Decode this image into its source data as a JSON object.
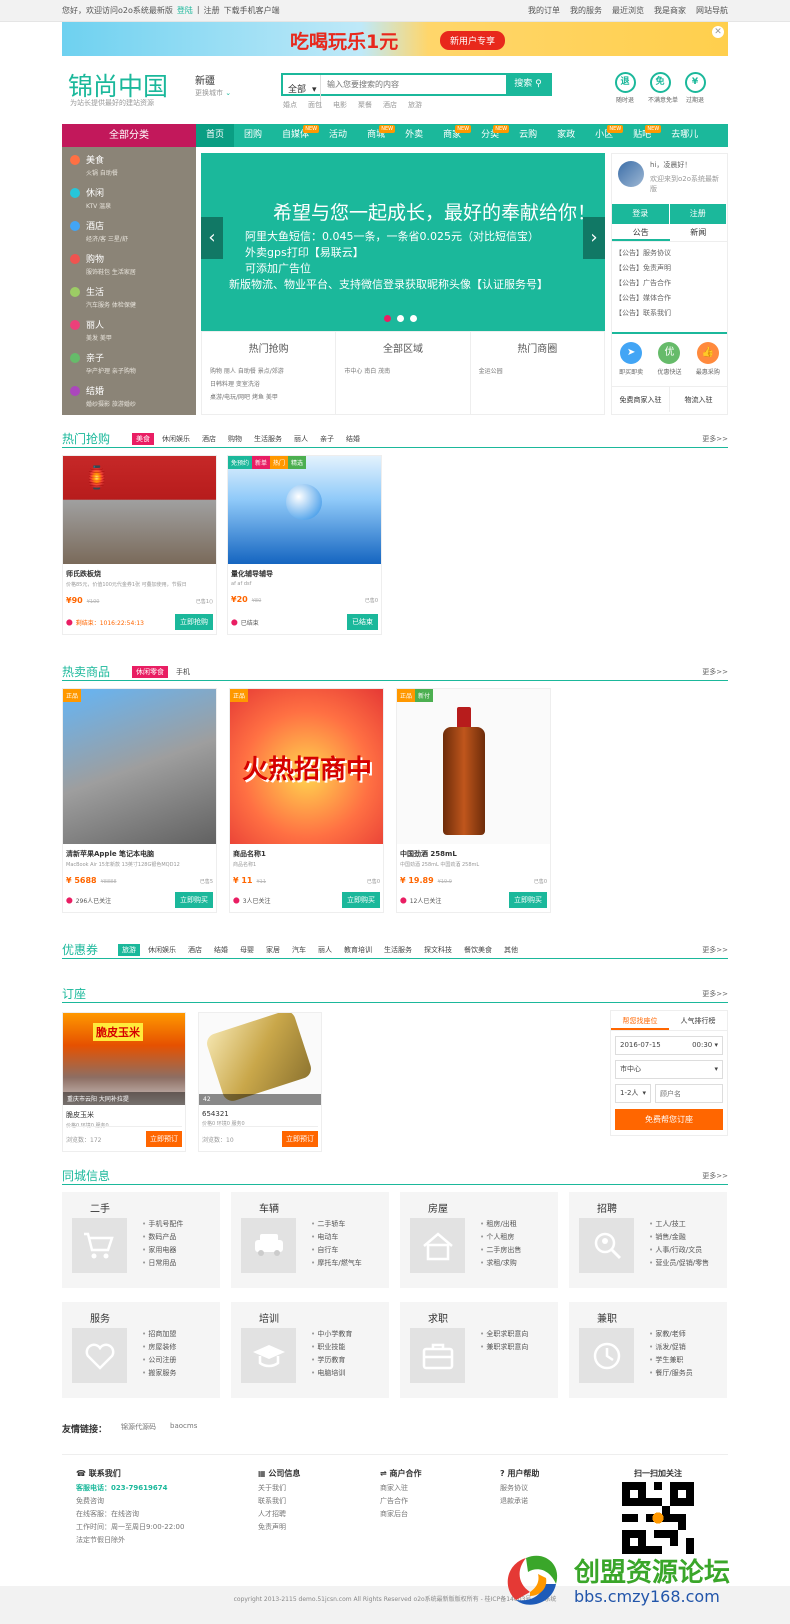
{
  "topbar": {
    "greeting": "您好，欢迎访问o2o系统最新版",
    "login": "登陆",
    "sep": "|",
    "register": "注册",
    "download": "下载手机客户端",
    "links": [
      "我的订单",
      "我的服务",
      "最近浏览",
      "我是商家",
      "网站导航"
    ]
  },
  "banner": {
    "text": "吃喝玩乐1元",
    "pill": "新用户专享",
    "close": "✕"
  },
  "header": {
    "logo": "锦尚中国",
    "logo_sub": "为站长提供最好的建站资源",
    "city": "新疆",
    "city_sub": "更换城市",
    "search_cat": "全部",
    "search_placeholder": "输入您要搜索的内容",
    "search_btn": "搜索",
    "hotwords": [
      "婚点",
      "面包",
      "电影",
      "聚餐",
      "酒店",
      "旅游"
    ],
    "services": [
      {
        "icon": "退",
        "label": "随时退"
      },
      {
        "icon": "免",
        "label": "不满意免单"
      },
      {
        "icon": "¥",
        "label": "过期退"
      }
    ]
  },
  "nav": {
    "all": "全部分类",
    "items": [
      {
        "label": "首页",
        "badge": ""
      },
      {
        "label": "团购",
        "badge": ""
      },
      {
        "label": "自媒体",
        "badge": "NEW"
      },
      {
        "label": "活动",
        "badge": ""
      },
      {
        "label": "商城",
        "badge": "NEW"
      },
      {
        "label": "外卖",
        "badge": ""
      },
      {
        "label": "商家",
        "badge": "NEW"
      },
      {
        "label": "分类",
        "badge": "NEW"
      },
      {
        "label": "云购",
        "badge": ""
      },
      {
        "label": "家政",
        "badge": ""
      },
      {
        "label": "小区",
        "badge": "NEW"
      },
      {
        "label": "贴吧",
        "badge": "NEW"
      },
      {
        "label": "去哪儿",
        "badge": ""
      }
    ]
  },
  "categories": [
    {
      "name": "美食",
      "sub": "火锅  自助餐",
      "color": "#ff7043"
    },
    {
      "name": "休闲",
      "sub": "KTV  温泉",
      "color": "#26c6da"
    },
    {
      "name": "酒店",
      "sub": "经济/客  三星/舒",
      "color": "#42a5f5"
    },
    {
      "name": "购物",
      "sub": "服饰鞋包  生活家居",
      "color": "#ef5350"
    },
    {
      "name": "生活",
      "sub": "汽车服务  体检保健",
      "color": "#9ccc65"
    },
    {
      "name": "丽人",
      "sub": "美发  美甲",
      "color": "#ec407a"
    },
    {
      "name": "亲子",
      "sub": "孕产护理  亲子购物",
      "color": "#66bb6a"
    },
    {
      "name": "结婚",
      "sub": "婚纱摄影  旅游婚纱",
      "color": "#ab47bc"
    }
  ],
  "slider": {
    "headline": "希望与您一起成长，最好的奉献给你！",
    "lines": [
      "阿里大鱼短信：0.045一条，一条省0.025元（对比短信宝）",
      "外卖gps打印【易联云】",
      "可添加广告位",
      "新版物流、物业平台、支持微信登录获取昵称头像【认证服务号】"
    ],
    "prev": "‹",
    "next": "›"
  },
  "quick": [
    {
      "title": "热门抢购",
      "links": [
        "购物  丽人  自助餐  景点/郊游",
        "日韩料理  变室洗浴",
        "桌游/电玩/网吧  烤鱼  美甲"
      ]
    },
    {
      "title": "全部区域",
      "links": [
        "市中心  南白  茂南"
      ]
    },
    {
      "title": "热门商圈",
      "links": [
        "金运公园"
      ]
    }
  ],
  "rside": {
    "hi": "hi，",
    "greet": "凌晨好！",
    "welcome": "欢迎来到o2o系统最新版",
    "login": "登录",
    "register": "注册",
    "tabs": [
      "公告",
      "新闻"
    ],
    "notices": [
      "【公告】服务协议",
      "【公告】免责声明",
      "【公告】广告合作",
      "【公告】媒体合作",
      "【公告】联系我们"
    ],
    "icons": [
      {
        "glyph": "➤",
        "label": "即买即卖",
        "color": "#42a5f5"
      },
      {
        "glyph": "优",
        "label": "优惠快送",
        "color": "#66bb6a"
      },
      {
        "glyph": "👍",
        "label": "最惠采购",
        "color": "#ff8a3d"
      }
    ],
    "foot": [
      "免费商家入驻",
      "物流入驻"
    ]
  },
  "hot_buy": {
    "title": "热门抢购",
    "tabs": [
      "美食",
      "休闲娱乐",
      "酒店",
      "购物",
      "生活服务",
      "丽人",
      "亲子",
      "结婚"
    ],
    "more": "更多>>",
    "items": [
      {
        "name": "师氏跌板烧",
        "desc": "价格85元，价值100元代金券1张 可叠加使用，节假日",
        "price": "¥90",
        "old": "¥100",
        "sold": "已售1()",
        "time": "剩结束：1016:22:54:13",
        "btn": "立即抢购",
        "tags": []
      },
      {
        "name": "量化辅导辅导",
        "desc": "af af dsf",
        "price": "¥20",
        "old": "¥80",
        "sold": "已售0",
        "time": "已结束",
        "btn": "已结束",
        "tags": [
          {
            "t": "免预约",
            "c": "#1bb89b"
          },
          {
            "t": "新单",
            "c": "#e91e63"
          },
          {
            "t": "热门",
            "c": "#ff9800"
          },
          {
            "t": "精选",
            "c": "#4caf50"
          }
        ]
      }
    ]
  },
  "hot_goods": {
    "title": "热卖商品",
    "tabs": [
      "休闲零食",
      "手机"
    ],
    "more": "更多>>",
    "items": [
      {
        "name": "清新苹果Apple 笔记本电脑",
        "desc": "MacBook Air 15年新款 13英寸128G银色MQD12",
        "price": "¥ 5688",
        "old": "¥8888",
        "sold": "已售5",
        "fav": "296人已关注",
        "btn": "立即购买",
        "tags": [
          {
            "t": "正品",
            "c": "#ff9800"
          }
        ]
      },
      {
        "name": "商品名称1",
        "desc": "商品名称1",
        "price": "¥ 11",
        "old": "¥11",
        "sold": "已售0",
        "fav": "3人已关注",
        "btn": "立即购买",
        "tags": [
          {
            "t": "正品",
            "c": "#ff9800"
          }
        ]
      },
      {
        "name": "中国劲酒 258mL",
        "desc": "中国劲酒 258mL 中国劲酒 258mL",
        "price": "¥ 19.89",
        "old": "¥19.9",
        "sold": "已售0",
        "fav": "12人已关注",
        "btn": "立即购买",
        "tags": [
          {
            "t": "正品",
            "c": "#ff9800"
          },
          {
            "t": "新付",
            "c": "#4caf50"
          }
        ]
      }
    ]
  },
  "coupons": {
    "title": "优惠券",
    "tabs": [
      "旅游",
      "休闲娱乐",
      "酒店",
      "结婚",
      "母婴",
      "家居",
      "汽车",
      "丽人",
      "教育培训",
      "生活服务",
      "探文科技",
      "餐饮美食",
      "其他"
    ],
    "more": "更多>>"
  },
  "booking": {
    "title": "订座",
    "more": "更多>>",
    "items": [
      {
        "overlay": "重庆市云阳 大同补拉提",
        "name": "脆皮玉米",
        "meta": "价格0  环境0  服务0",
        "views": "浏览数：172",
        "btn": "立即预订"
      },
      {
        "overlay": "42",
        "name": "654321",
        "meta": "价格0  环境0  服务0",
        "views": "浏览数：10",
        "btn": "立即预订"
      }
    ],
    "panel": {
      "tabs": [
        "帮您找座位",
        "人气排行榜"
      ],
      "date": "2016-07-15",
      "time": "00:30",
      "area": "市中心",
      "people": "1-2人",
      "placeholder": "顾户名",
      "submit": "免费帮您订座"
    }
  },
  "city_info": {
    "title": "同城信息",
    "more": "更多>>",
    "boxes": [
      {
        "h": "二手",
        "icon": "cart-icon",
        "items": [
          "手机号配件",
          "数码产品",
          "家用电器",
          "日常用品"
        ]
      },
      {
        "h": "车辆",
        "icon": "car-icon",
        "items": [
          "二手轿车",
          "电动车",
          "自行车",
          "摩托车/燃气车"
        ]
      },
      {
        "h": "房屋",
        "icon": "house-icon",
        "items": [
          "租房/出租",
          "个人租房",
          "二手房出售",
          "求租/求购"
        ]
      },
      {
        "h": "招聘",
        "icon": "search-person-icon",
        "items": [
          "工人/技工",
          "销售/金融",
          "人事/行政/文员",
          "营业员/促销/零售"
        ]
      },
      {
        "h": "服务",
        "icon": "heart-icon",
        "items": [
          "招商加盟",
          "房屋装修",
          "公司注册",
          "搬家服务"
        ]
      },
      {
        "h": "培训",
        "icon": "grad-cap-icon",
        "items": [
          "中小学教育",
          "职业技能",
          "学历教育",
          "电脑培训"
        ]
      },
      {
        "h": "求职",
        "icon": "briefcase-icon",
        "items": [
          "全职求职意向",
          "兼职求职意向"
        ]
      },
      {
        "h": "兼职",
        "icon": "clock-icon",
        "items": [
          "家教/老师",
          "派发/促销",
          "学生兼职",
          "餐厅/服务员"
        ]
      }
    ]
  },
  "links": {
    "label": "友情链接：",
    "items": [
      "锦源代源码",
      "baocms"
    ]
  },
  "footer": {
    "cols": [
      {
        "h": "联系我们",
        "lines": [
          "客服电话：023-79619674",
          "免费咨询",
          "在线客服：在线咨询",
          "工作时间：周一至周日9:00-22:00",
          "法定节假日除外"
        ]
      },
      {
        "h": "公司信息",
        "lines": [
          "关于我们",
          "联系我们",
          "人才招聘",
          "免责声明"
        ]
      },
      {
        "h": "商户合作",
        "lines": [
          "商家入驻",
          "广告合作",
          "商家后台"
        ]
      },
      {
        "h": "用户帮助",
        "lines": [
          "服务协议",
          "退款承诺"
        ]
      }
    ],
    "qr_title": "扫一扫加关注",
    "copyright": "copyright 2013-2115 demo.51jcsn.com All Rights Reserved o2o系统最新版版权所有 - 桂ICP备14003号 o2o系统"
  },
  "watermark": {
    "title": "创盟资源论坛",
    "url": "bbs.cmzy168.com"
  }
}
